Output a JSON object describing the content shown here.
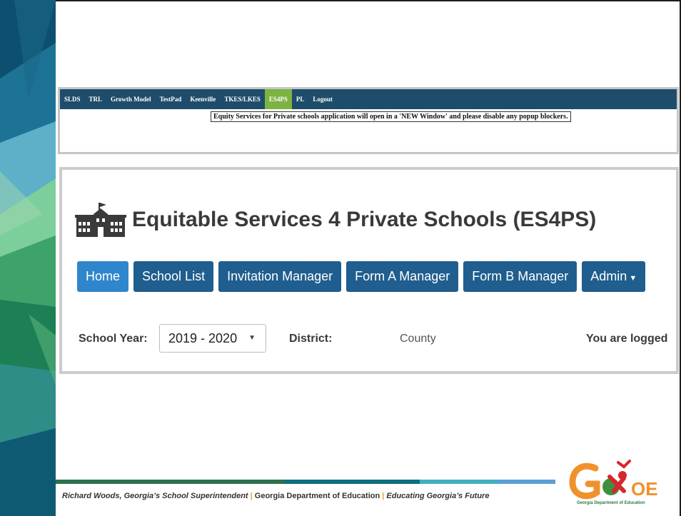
{
  "portal": {
    "nav": [
      "SLDS",
      "TRL",
      "Growth Model",
      "TestPad",
      "Keenville",
      "TKES/LKES",
      "ES4PS",
      "PL",
      "Logout"
    ],
    "active": "ES4PS",
    "tooltip": "Equity Services for Private schools application will open in a 'NEW Window' and please disable any popup blockers."
  },
  "app": {
    "title": "Equitable Services 4 Private Schools (ES4PS)",
    "buttons": [
      "Home",
      "School List",
      "Invitation Manager",
      "Form A Manager",
      "Form B Manager",
      "Admin"
    ],
    "school_year_label": "School Year:",
    "school_year_value": "2019 - 2020",
    "district_label": "District:",
    "district_value": "County",
    "logged_in_text": "You are logged"
  },
  "footer": {
    "superintendent": "Richard Woods, Georgia’s School Superintendent",
    "separator": "|",
    "department": "Georgia Department of Education",
    "slogan": "Educating Georgia’s Future"
  },
  "logo": {
    "caption": "Georgia Department of Education",
    "colors": {
      "orange": "#f0922c",
      "green": "#3e8f3e",
      "red": "#d8262d"
    }
  },
  "colors": {
    "nav_bg": "#1e4d6b",
    "nav_active": "#7cb342",
    "button": "#1f5e8e",
    "button_active": "#2f86cc"
  }
}
